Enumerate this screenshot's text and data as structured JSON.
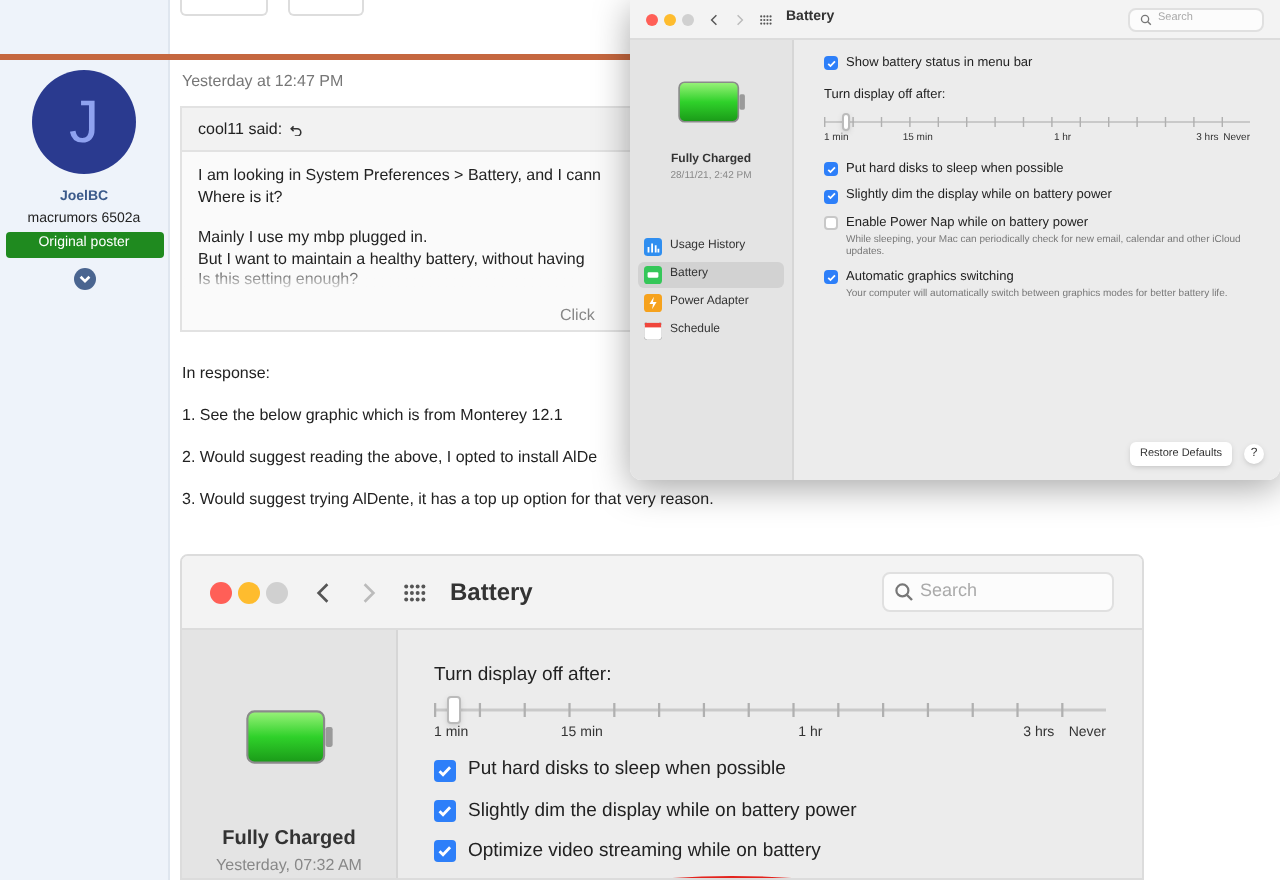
{
  "post": {
    "timestamp": "Yesterday at 12:47 PM",
    "author": {
      "initial": "J",
      "name": "JoelBC",
      "rank": "macrumors 6502a",
      "badge": "Original poster"
    },
    "quote": {
      "attribution": "cool11 said:",
      "collapsed": true,
      "paragraphs": [
        [
          "I am looking in System Preferences > Battery, and I cann",
          "Where is it?"
        ],
        [
          "Mainly I use my mbp plugged in.",
          "But I want to maintain a healthy battery, without having",
          "Is this setting enough?"
        ]
      ],
      "expand": "Click"
    },
    "paragraphs": [
      "In response:",
      "1. See the below graphic which is from Monterey 12.1",
      "2. Would suggest reading the above, I opted to install AlDe",
      "3. Would suggest trying AlDente, it has a top up option for that very reason."
    ]
  },
  "prefs_window": {
    "title": "Battery",
    "search_placeholder": "Search",
    "status": "Fully Charged",
    "status_time": "28/11/21, 2:42 PM",
    "sidebar": [
      {
        "label": "Usage History",
        "selected": false
      },
      {
        "label": "Battery",
        "selected": true
      },
      {
        "label": "Power Adapter",
        "selected": false
      },
      {
        "label": "Schedule",
        "selected": false
      }
    ],
    "options": [
      {
        "kind": "checkbox",
        "label": "Show battery status in menu bar",
        "checked": true
      },
      {
        "kind": "slider",
        "label": "Turn display off after:",
        "level": 0.05,
        "ticks": [
          "1 min",
          "15 min",
          "1 hr",
          "3 hrs",
          "Never"
        ]
      },
      {
        "kind": "checkbox",
        "label": "Put hard disks to sleep when possible",
        "checked": true
      },
      {
        "kind": "checkbox",
        "label": "Slightly dim the display while on battery power",
        "checked": true
      },
      {
        "kind": "checkbox",
        "label": "Enable Power Nap while on battery power",
        "checked": false,
        "description": "While sleeping, your Mac can periodically check for new email, calendar and other iCloud updates."
      },
      {
        "kind": "checkbox",
        "label": "Automatic graphics switching",
        "checked": true,
        "description": "Your computer will automatically switch between graphics modes for better battery life."
      }
    ],
    "restore_button": "Restore Defaults",
    "help_button": "?"
  },
  "embedded_screenshot": {
    "title": "Battery",
    "search_placeholder": "Search",
    "status": "Fully Charged",
    "status_time": "Yesterday, 07:32 AM",
    "options": [
      {
        "kind": "slider",
        "label": "Turn display off after:",
        "level": 0.03,
        "ticks": [
          "1 min",
          "15 min",
          "1 hr",
          "3 hrs",
          "Never"
        ]
      },
      {
        "kind": "checkbox",
        "label": "Put hard disks to sleep when possible",
        "checked": true
      },
      {
        "kind": "checkbox",
        "label": "Slightly dim the display while on battery power",
        "checked": true
      },
      {
        "kind": "checkbox",
        "label": "Optimize video streaming while on battery",
        "checked": true
      }
    ],
    "annotation": {
      "kind": "ellipse"
    }
  }
}
